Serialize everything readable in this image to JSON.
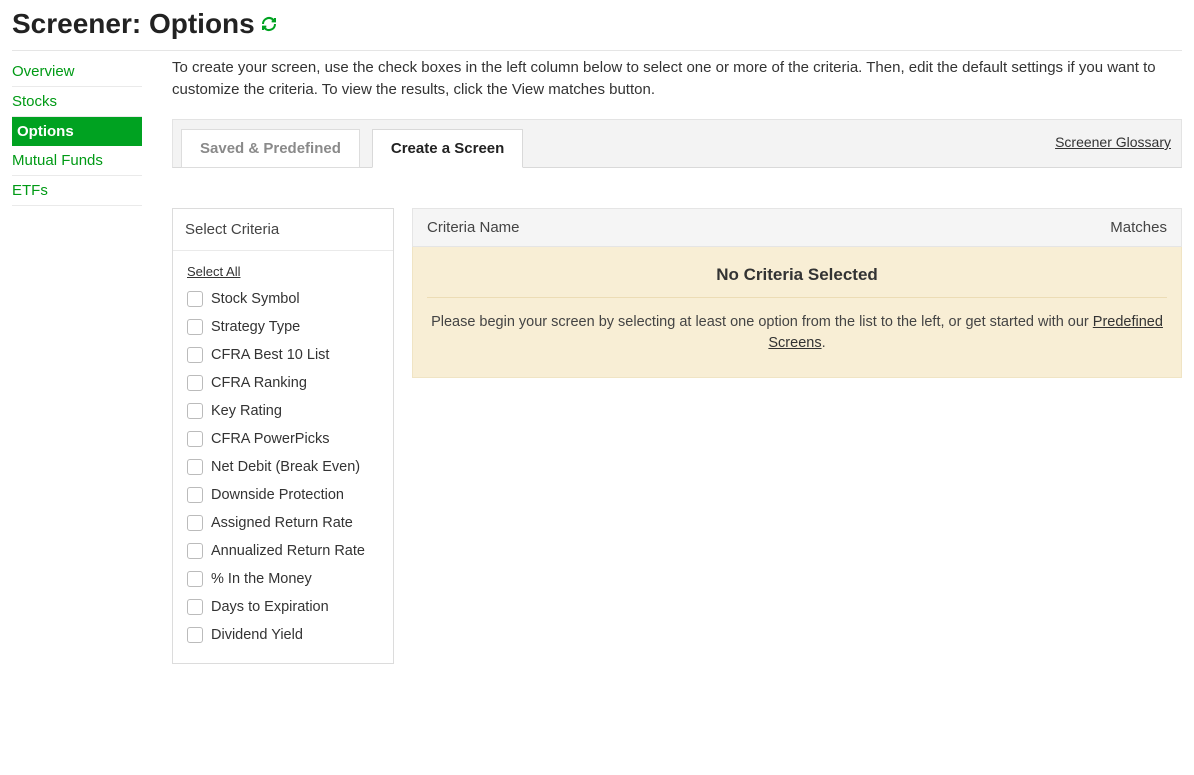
{
  "page_title": "Screener: Options",
  "sidebar": {
    "items": [
      {
        "label": "Overview",
        "active": false
      },
      {
        "label": "Stocks",
        "active": false
      },
      {
        "label": "Options",
        "active": true
      },
      {
        "label": "Mutual Funds",
        "active": false
      },
      {
        "label": "ETFs",
        "active": false
      }
    ]
  },
  "intro_text": "To create your screen, use the check boxes in the left column below to select one or more of the criteria. Then, edit the default settings if you want to customize the criteria. To view the results, click the View matches button.",
  "tabs": {
    "saved": "Saved & Predefined",
    "create": "Create a Screen"
  },
  "glossary_link": "Screener Glossary",
  "criteria_panel": {
    "header": "Select Criteria",
    "select_all": "Select All",
    "items": [
      "Stock Symbol",
      "Strategy Type",
      "CFRA Best 10 List",
      "CFRA Ranking",
      "Key Rating",
      "CFRA PowerPicks",
      "Net Debit (Break Even)",
      "Downside Protection",
      "Assigned Return Rate",
      "Annualized Return Rate",
      "% In the Money",
      "Days to Expiration",
      "Dividend Yield"
    ]
  },
  "results": {
    "col_name": "Criteria Name",
    "col_matches": "Matches",
    "empty_title": "No Criteria Selected",
    "empty_text_prefix": "Please begin your screen by selecting at least one option from the list to the left, or get started with our ",
    "predefined_link": "Predefined Screens",
    "empty_text_suffix": "."
  }
}
